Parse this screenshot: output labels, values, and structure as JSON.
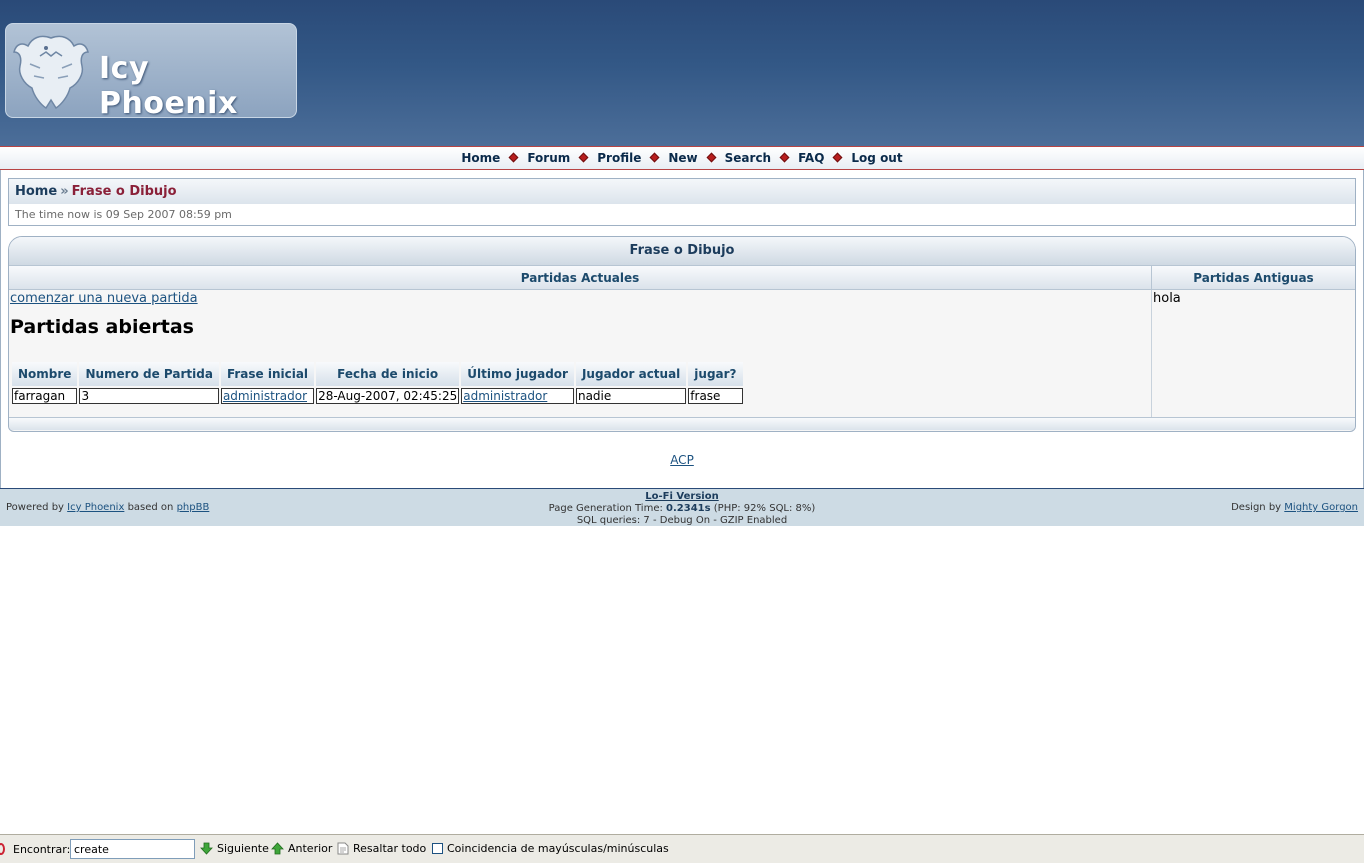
{
  "colors": {
    "header_bg": "#2f5281",
    "nav_separator": "#b81e1e",
    "breadcrumb_current": "#8a2038",
    "footer_bg": "#cddbe4"
  },
  "header": {
    "logo_text": "Icy Phoenix",
    "logo_icon": "phoenix-bird-icon"
  },
  "nav": {
    "items": [
      "Home",
      "Forum",
      "Profile",
      "New",
      "Search",
      "FAQ",
      "Log out"
    ]
  },
  "breadcrumb": {
    "home": "Home",
    "separator": "»",
    "current": "Frase o Dibujo",
    "time_now": "The time now is 09 Sep 2007 08:59 pm"
  },
  "panel": {
    "title": "Frase o Dibujo",
    "col_actuales": "Partidas Actuales",
    "col_antiguas": "Partidas Antiguas",
    "new_game_link": "comenzar una nueva partida",
    "open_games_title": "Partidas abiertas",
    "antiguas_text": "hola",
    "table": {
      "headers": [
        "Nombre",
        "Numero de Partida",
        "Frase inicial",
        "Fecha de inicio",
        "Último jugador",
        "Jugador actual",
        "jugar?"
      ],
      "rows": [
        [
          "farragan",
          "3",
          "administrador",
          "28-Aug-2007, 02:45:25",
          "administrador",
          "nadie",
          "frase"
        ]
      ]
    }
  },
  "acp": "ACP",
  "footer": {
    "powered_prefix": "Powered by",
    "powered_link1": "Icy Phoenix",
    "powered_mid": "based on",
    "powered_link2": "phpBB",
    "lofi": "Lo-Fi Version",
    "gen_prefix": "Page Generation Time:",
    "gen_time": "0.2341s",
    "gen_suffix": "(PHP: 92% SQL: 8%)",
    "sql_line": "SQL queries: 7 - Debug On - GZIP Enabled",
    "design_prefix": "Design by",
    "design_link": "Mighty Gorgon"
  },
  "findbar": {
    "label": "Encontrar:",
    "value": "create",
    "next": "Siguiente",
    "prev": "Anterior",
    "highlight": "Resaltar todo",
    "match_case": "Coincidencia de mayúsculas/minúsculas"
  }
}
